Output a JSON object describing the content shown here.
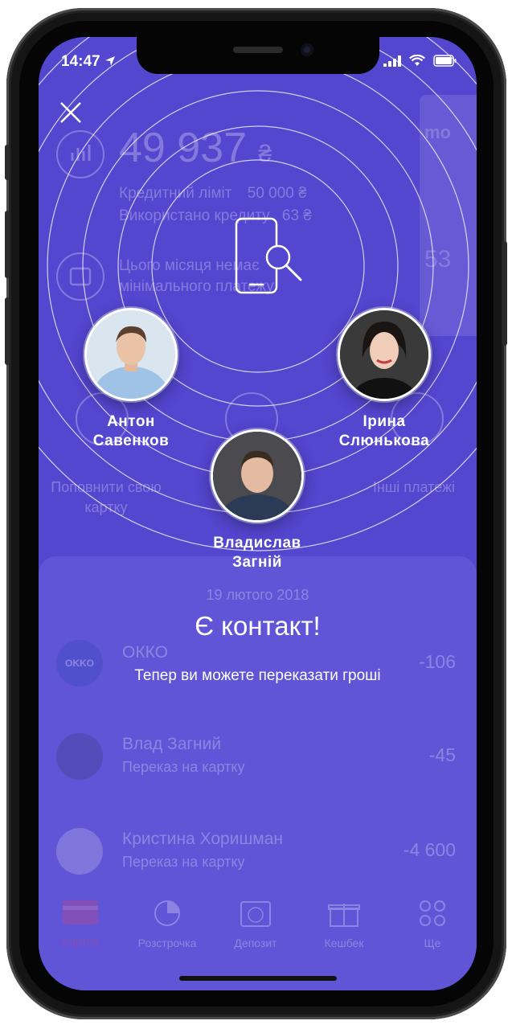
{
  "status_bar": {
    "time": "14:47"
  },
  "background_card": {
    "balance": "49 937",
    "currency": "₴",
    "credit_limit_label": "Кредитний ліміт",
    "credit_limit_value": "50 000 ₴",
    "used_credit_label": "Використано кредиту",
    "used_credit_value": "63 ₴",
    "notice": "Цього місяця немає мінімального платежу",
    "side_card_text": "mo",
    "side_card_number": "53"
  },
  "background_actions": {
    "topup_label": "Поповнити свою картку",
    "other_label": "Інші платежі"
  },
  "transactions": {
    "date": "19 лютого 2018",
    "items": [
      {
        "title": "ОККО",
        "subtitle": "",
        "amount": "-106",
        "logo_text": "OKKO"
      },
      {
        "title": "Влад Загний",
        "subtitle": "Переказ на картку",
        "amount": "-45"
      },
      {
        "title": "Кристина Хоришман",
        "subtitle": "Переказ на картку",
        "amount": "-4 600"
      }
    ]
  },
  "contacts": [
    {
      "name_line1": "Антон",
      "name_line2": "Савенков"
    },
    {
      "name_line1": "Ірина",
      "name_line2": "Слюнькова"
    },
    {
      "name_line1": "Владислав",
      "name_line2": "Загній"
    }
  ],
  "overlay": {
    "headline": "Є контакт!",
    "message": "Тепер ви можете переказати гроші"
  },
  "tabbar": {
    "tabs": [
      {
        "label": "Картка",
        "icon": "card-icon"
      },
      {
        "label": "Розстрочка",
        "icon": "pie-chart-icon"
      },
      {
        "label": "Депозит",
        "icon": "calendar-15-icon"
      },
      {
        "label": "Кешбек",
        "icon": "gift-icon"
      },
      {
        "label": "Ще",
        "icon": "more-circles-icon"
      }
    ],
    "active_color": "#e0416f"
  },
  "colors": {
    "background": "#5346cf",
    "panel": "#5f55d6",
    "accent": "#e0416f"
  }
}
